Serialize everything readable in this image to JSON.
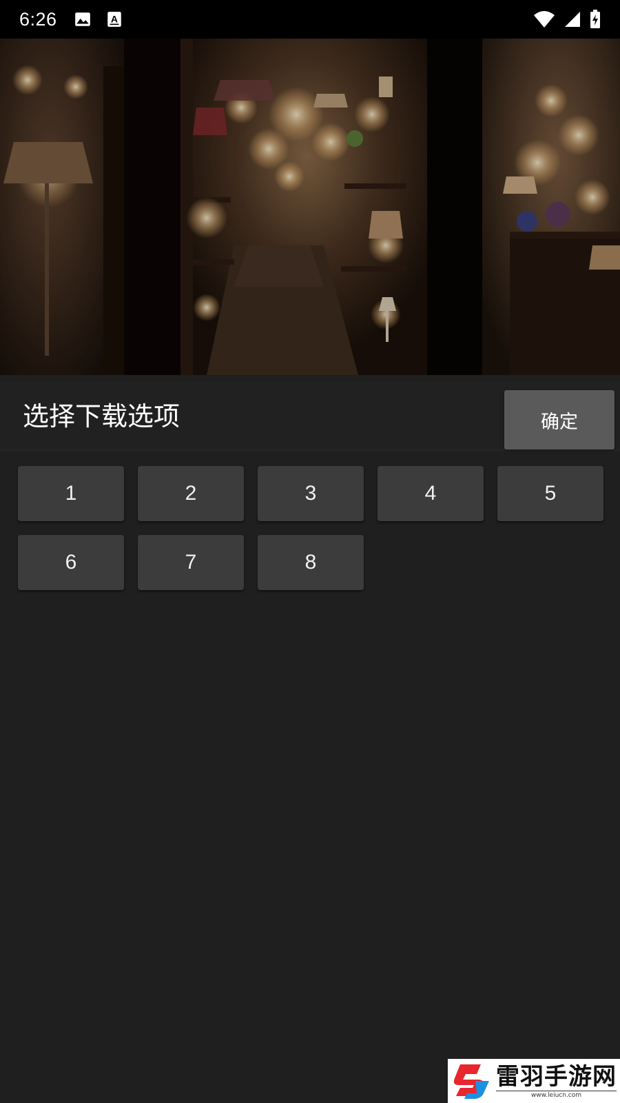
{
  "status_bar": {
    "time": "6:26",
    "left_icons": [
      "image-icon",
      "font-a-icon"
    ],
    "right_icons": [
      "wifi-icon",
      "signal-icon",
      "battery-charging-icon"
    ]
  },
  "media": {
    "description_icon": "lamp-shop-image"
  },
  "dialog": {
    "title": "选择下载选项",
    "confirm_label": "确定"
  },
  "options": [
    "1",
    "2",
    "3",
    "4",
    "5",
    "6",
    "7",
    "8"
  ],
  "watermark": {
    "title": "雷羽手游网",
    "url": "www.leiucn.com"
  },
  "colors": {
    "background": "#1f1f1f",
    "header": "#212121",
    "option_button": "#3c3c3c",
    "confirm_button": "#5a5a5a",
    "status_bar": "#000000",
    "logo_red": "#e8262f",
    "logo_blue": "#1e8fe0"
  }
}
